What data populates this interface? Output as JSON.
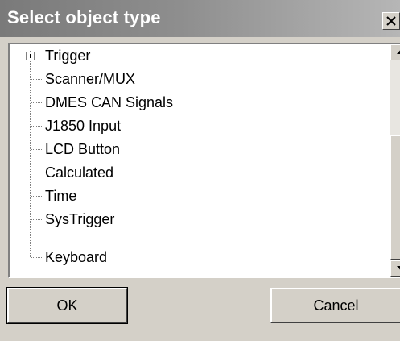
{
  "window": {
    "title": "Select object type",
    "close_glyph": "close-icon"
  },
  "tree": {
    "items": [
      {
        "label": "Trigger",
        "expandable": true
      },
      {
        "label": "Scanner/MUX",
        "expandable": false
      },
      {
        "label": "DMES CAN Signals",
        "expandable": false
      },
      {
        "label": "J1850 Input",
        "expandable": false
      },
      {
        "label": "LCD Button",
        "expandable": false
      },
      {
        "label": "Calculated",
        "expandable": false
      },
      {
        "label": "Time",
        "expandable": false
      },
      {
        "label": "SysTrigger",
        "expandable": false
      },
      {
        "label": "Keyboard",
        "expandable": false
      }
    ]
  },
  "scrollbar": {
    "up_icon": "arrow-up-icon",
    "down_icon": "arrow-down-icon"
  },
  "buttons": {
    "ok_label": "OK",
    "cancel_label": "Cancel"
  },
  "colors": {
    "titlebar": "#7a7a7a",
    "face": "#d4d0c8",
    "list_bg": "#ffffff"
  }
}
